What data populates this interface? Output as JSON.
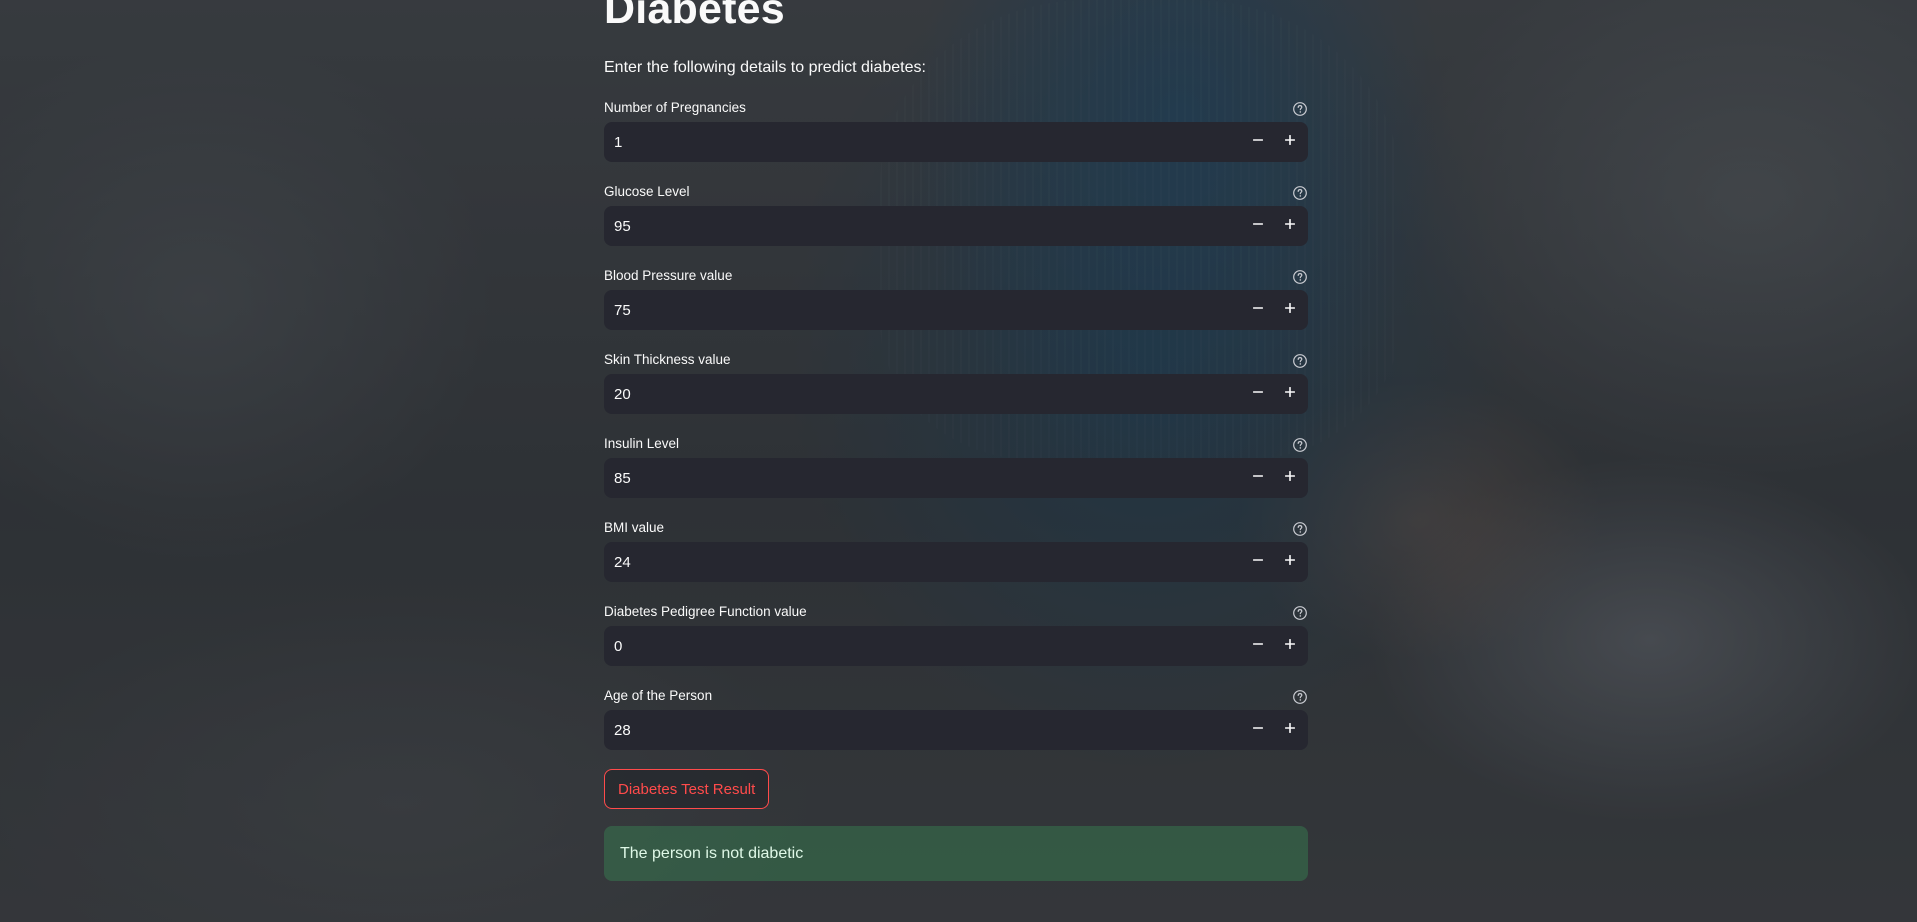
{
  "page": {
    "title": "Diabetes",
    "subtitle": "Enter the following details to predict diabetes:"
  },
  "fields": [
    {
      "label": "Number of Pregnancies",
      "value": "1"
    },
    {
      "label": "Glucose Level",
      "value": "95"
    },
    {
      "label": "Blood Pressure value",
      "value": "75"
    },
    {
      "label": "Skin Thickness value",
      "value": "20"
    },
    {
      "label": "Insulin Level",
      "value": "85"
    },
    {
      "label": "BMI value",
      "value": "24"
    },
    {
      "label": "Diabetes Pedigree Function value",
      "value": "0"
    },
    {
      "label": "Age of the Person",
      "value": "28"
    }
  ],
  "actions": {
    "submit_label": "Diabetes Test Result"
  },
  "result": {
    "message": "The person is not diabetic"
  },
  "icons": {
    "help": "question-circle-icon",
    "decrement": "minus-icon",
    "increment": "plus-icon"
  },
  "colors": {
    "accent": "#ff4b4b",
    "input_bg": "#262730",
    "text": "#fafafa",
    "success_bg": "#3dd56d"
  }
}
